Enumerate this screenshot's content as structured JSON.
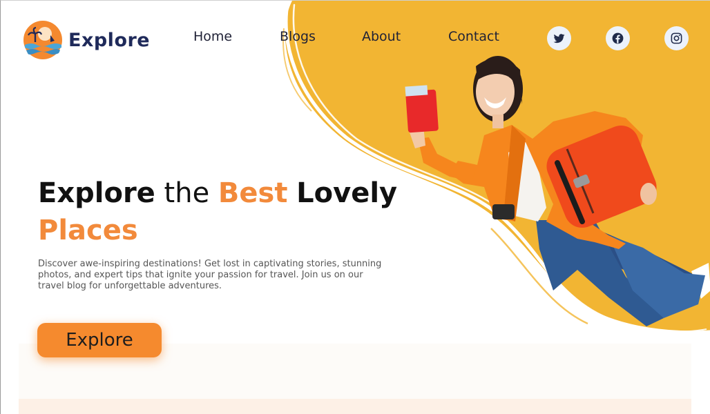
{
  "brand": {
    "name": "Explore",
    "logo_icon": "sun-palm-wave-logo-icon"
  },
  "nav": {
    "items": [
      {
        "label": "Home"
      },
      {
        "label": "Blogs"
      },
      {
        "label": "About"
      },
      {
        "label": "Contact"
      }
    ]
  },
  "social": [
    {
      "icon": "twitter-icon"
    },
    {
      "icon": "facebook-icon"
    },
    {
      "icon": "instagram-icon"
    }
  ],
  "hero": {
    "headline": {
      "w1": "Explore",
      "w2": "the",
      "w3": "Best",
      "w4": "Lovely",
      "w5": "Places"
    },
    "description": "Discover awe-inspiring destinations! Get lost in captivating stories, stunning photos, and expert tips that ignite your passion for travel. Join us on our travel blog for unforgettable adventures.",
    "cta_label": "Explore",
    "photo": "traveler-with-suitcase-photo"
  },
  "colors": {
    "accent": "#f28a3b",
    "button": "#f58a2e",
    "hero_yellow": "#f2b533",
    "brand_navy": "#1f2a5a",
    "social_bg": "#ecf2fb"
  }
}
